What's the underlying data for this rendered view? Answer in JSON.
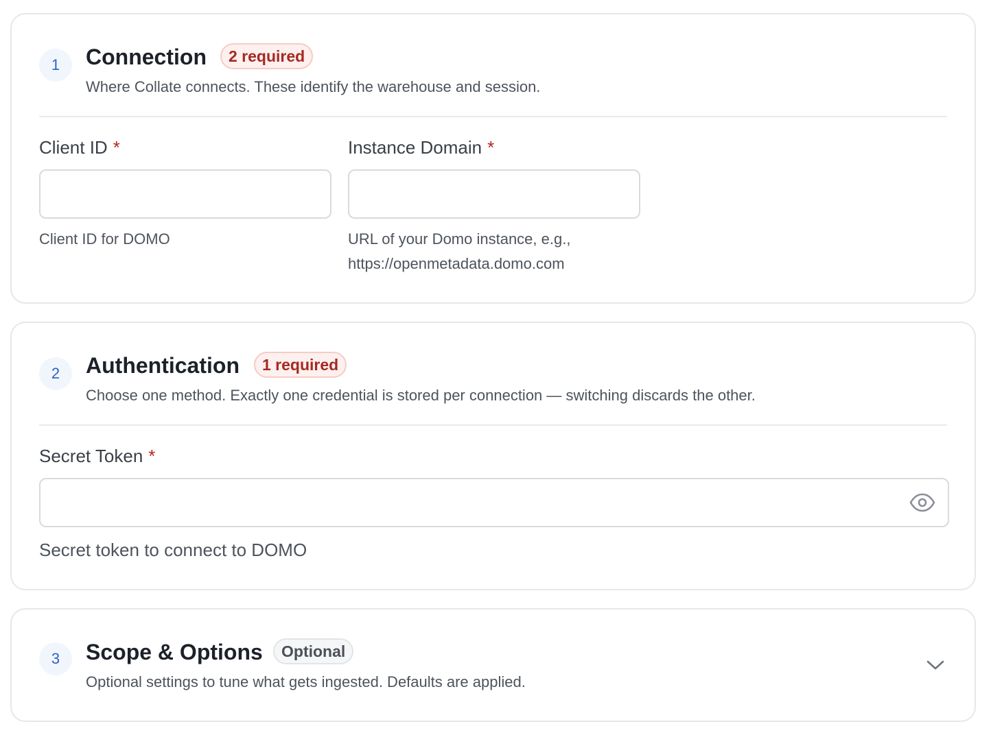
{
  "sections": [
    {
      "number": "1",
      "title": "Connection",
      "badge": "2 required",
      "description": "Where Collate connects. These identify the warehouse and session.",
      "fields": [
        {
          "label": "Client ID",
          "required_mark": "*",
          "value": "",
          "help": "Client ID for DOMO"
        },
        {
          "label": "Instance Domain",
          "required_mark": "*",
          "value": "",
          "help_line1": "URL of your Domo instance, e.g.,",
          "help_line2": "https://openmetadata.domo.com"
        }
      ]
    },
    {
      "number": "2",
      "title": "Authentication",
      "badge": "1 required",
      "description": "Choose one method. Exactly one credential is stored per connection — switching discards the other.",
      "fields": [
        {
          "label": "Secret Token",
          "required_mark": "*",
          "value": "",
          "help": "Secret token to connect to DOMO",
          "icon": "eye-icon"
        }
      ]
    },
    {
      "number": "3",
      "title": "Scope & Options",
      "badge": "Optional",
      "description": "Optional settings to tune what gets ingested. Defaults are applied.",
      "icon": "chevron-down-icon"
    }
  ],
  "colors": {
    "accent": "#2b63c7",
    "required": "#b3261e",
    "border": "#e6e7ea"
  }
}
